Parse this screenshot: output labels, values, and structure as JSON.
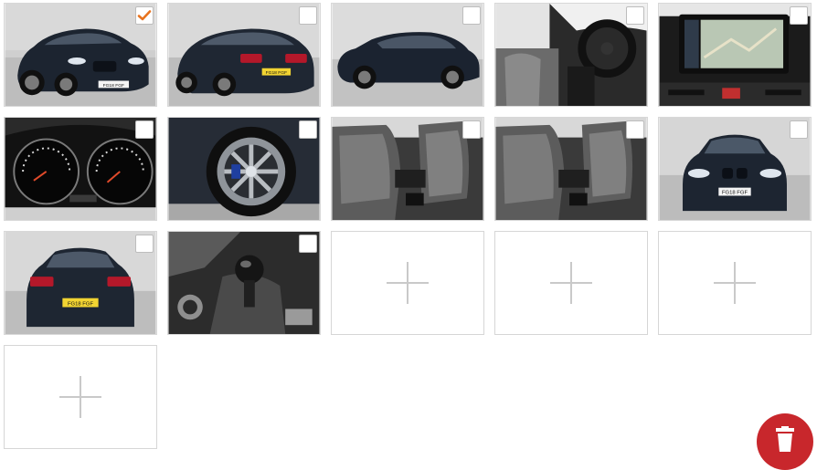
{
  "gallery": {
    "photos": [
      {
        "name": "car-front-three-quarter",
        "plate": "FG18 FGF",
        "selected": true
      },
      {
        "name": "car-rear-three-quarter",
        "plate": "FG18 FGF",
        "selected": false
      },
      {
        "name": "car-side-profile",
        "plate": "",
        "selected": false
      },
      {
        "name": "interior-dashboard-steering",
        "plate": "",
        "selected": false
      },
      {
        "name": "infotainment-navigation-screen",
        "plate": "",
        "selected": false
      },
      {
        "name": "instrument-cluster",
        "plate": "",
        "selected": false
      },
      {
        "name": "alloy-wheel",
        "plate": "",
        "selected": false
      },
      {
        "name": "front-seats",
        "plate": "",
        "selected": false
      },
      {
        "name": "front-seats-duplicate",
        "plate": "",
        "selected": false
      },
      {
        "name": "car-front-view",
        "plate": "FG18 FGF",
        "selected": false
      },
      {
        "name": "car-rear-view",
        "plate": "FG18 FGF",
        "selected": false
      },
      {
        "name": "gear-shifter",
        "plate": "",
        "selected": false
      }
    ],
    "empty_slots": 4,
    "check_color": "#e8731e",
    "delete_color": "#c8272c"
  },
  "actions": {
    "delete_icon": "trash-icon",
    "add_icon": "plus-icon"
  }
}
